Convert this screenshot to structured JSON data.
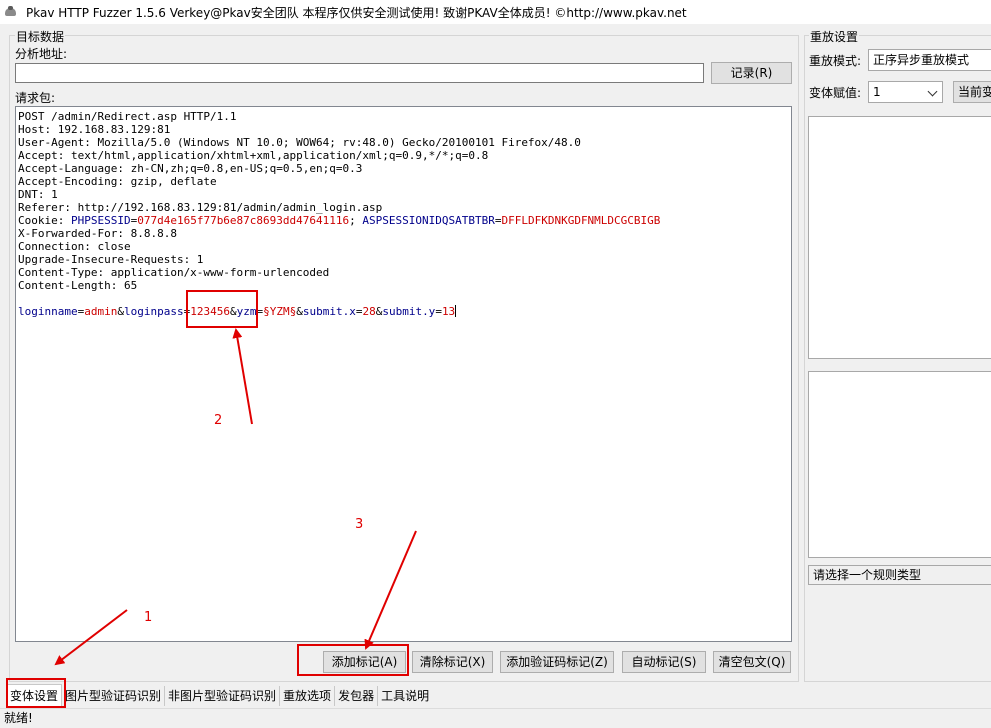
{
  "window": {
    "title": "Pkav HTTP Fuzzer 1.5.6  Verkey@Pkav安全团队  本程序仅供安全测试使用!  致谢PKAV全体成员! ©http://www.pkav.net"
  },
  "target": {
    "group_label": "目标数据",
    "address_label": "分析地址:",
    "address_value": "",
    "record_button": "记录(R)",
    "request_label": "请求包:"
  },
  "request_lines": [
    [
      {
        "t": "POST /admin/Redirect.asp HTTP/1.1",
        "c": "p"
      }
    ],
    [
      {
        "t": "Host: 192.168.83.129:81",
        "c": "p"
      }
    ],
    [
      {
        "t": "User-Agent: Mozilla/5.0 (Windows NT 10.0; WOW64; rv:48.0) Gecko/20100101 Firefox/48.0",
        "c": "p"
      }
    ],
    [
      {
        "t": "Accept: text/html,application/xhtml+xml,application/xml;q=0.9,*/*;q=0.8",
        "c": "p"
      }
    ],
    [
      {
        "t": "Accept-Language: zh-CN,zh;q=0.8,en-US;q=0.5,en;q=0.3",
        "c": "p"
      }
    ],
    [
      {
        "t": "Accept-Encoding: gzip, deflate",
        "c": "p"
      }
    ],
    [
      {
        "t": "DNT: 1",
        "c": "p"
      }
    ],
    [
      {
        "t": "Referer: http://192.168.83.129:81/admin/admin_login.asp",
        "c": "p"
      }
    ],
    [
      {
        "t": "Cookie: ",
        "c": "p"
      },
      {
        "t": "PHPSESSID",
        "c": "k"
      },
      {
        "t": "=",
        "c": "p"
      },
      {
        "t": "077d4e165f77b6e87c8693dd47641116",
        "c": "v"
      },
      {
        "t": "; ",
        "c": "p"
      },
      {
        "t": "ASPSESSIONIDQSATBTBR",
        "c": "k"
      },
      {
        "t": "=",
        "c": "p"
      },
      {
        "t": "DFFLDFKDNKGDFNMLDCGCBIGB",
        "c": "v"
      }
    ],
    [
      {
        "t": "X-Forwarded-For: 8.8.8.8",
        "c": "p"
      }
    ],
    [
      {
        "t": "Connection: close",
        "c": "p"
      }
    ],
    [
      {
        "t": "Upgrade-Insecure-Requests: 1",
        "c": "p"
      }
    ],
    [
      {
        "t": "Content-Type: application/x-www-form-urlencoded",
        "c": "p"
      }
    ],
    [
      {
        "t": "Content-Length: 65",
        "c": "p"
      }
    ],
    [
      {
        "t": "",
        "c": "p"
      }
    ],
    [
      {
        "t": "loginname",
        "c": "k"
      },
      {
        "t": "=",
        "c": "p"
      },
      {
        "t": "admin",
        "c": "v"
      },
      {
        "t": "&",
        "c": "p"
      },
      {
        "t": "loginpass",
        "c": "k"
      },
      {
        "t": "=",
        "c": "p"
      },
      {
        "t": "123456",
        "c": "v"
      },
      {
        "t": "&",
        "c": "p"
      },
      {
        "t": "yzm",
        "c": "k"
      },
      {
        "t": "=",
        "c": "p"
      },
      {
        "t": "§YZM§",
        "c": "v"
      },
      {
        "t": "&",
        "c": "p"
      },
      {
        "t": "submit.x",
        "c": "k"
      },
      {
        "t": "=",
        "c": "p"
      },
      {
        "t": "28",
        "c": "v"
      },
      {
        "t": "&",
        "c": "p"
      },
      {
        "t": "submit.y",
        "c": "k"
      },
      {
        "t": "=",
        "c": "p"
      },
      {
        "t": "13",
        "c": "v"
      }
    ]
  ],
  "actions": {
    "add_mark": "添加标记(A)",
    "clear_mark": "清除标记(X)",
    "add_captcha_mark": "添加验证码标记(Z)",
    "auto_mark": "自动标记(S)",
    "clear_body": "清空包文(Q)"
  },
  "replay": {
    "group_label": "重放设置",
    "mode_label": "重放模式:",
    "mode_value": "正序异步重放模式",
    "var_label": "变体赋值:",
    "var_value": "1",
    "current_button": "当前变",
    "rule_type_placeholder": "请选择一个规则类型"
  },
  "tabs": [
    "变体设置",
    "图片型验证码识别",
    "非图片型验证码识别",
    "重放选项",
    "发包器",
    "工具说明"
  ],
  "status": "就绪!",
  "annotations": [
    "1",
    "2",
    "3"
  ],
  "colors": {
    "key": "#00008b",
    "value": "#cc0000",
    "annotation": "#e00000"
  }
}
